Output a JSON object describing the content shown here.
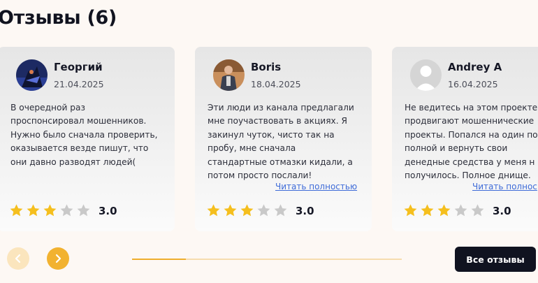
{
  "section": {
    "title": "Отзывы (6)"
  },
  "reviews": [
    {
      "name": "Георгий",
      "date": "21.04.2025",
      "text": "В очередной раз\nпроспонсировал мошенников.\nНужно было сначала проверить,\nоказывается везде пишут, что\nони давно разводят людей(",
      "rating": 3,
      "rating_label": "3.0",
      "read_more": ""
    },
    {
      "name": "Boris",
      "date": "18.04.2025",
      "text": "Эти люди из канала предлагали\nмне поучаствовать в акциях. Я\nзакинул чуток, чисто так на\nпробу, мне сначала\nстандартные отмазки кидали, а\nпотом просто послали!",
      "rating": 3,
      "rating_label": "3.0",
      "read_more": "Читать полностью"
    },
    {
      "name": "Andrey A",
      "date": "16.04.2025",
      "text": "Не ведитесь на этом проекте\nпродвигают мошеннические\nпроекты. Попался на один по\nполной и вернуть свои\nденедные средства у меня н\nполучилось. Полное днище.",
      "rating": 3,
      "rating_label": "3.0",
      "read_more": "Читать полнос"
    }
  ],
  "carousel": {
    "progress": 0.2
  },
  "actions": {
    "all_reviews_label": "Все отзывы"
  },
  "colors": {
    "star_on": "#f5bf1e",
    "star_off": "#c9c9c9",
    "accent": "#f2b230",
    "dark": "#101320"
  },
  "icons": {
    "prev": "chevron-left-icon",
    "next": "chevron-right-icon",
    "star": "star-icon"
  }
}
